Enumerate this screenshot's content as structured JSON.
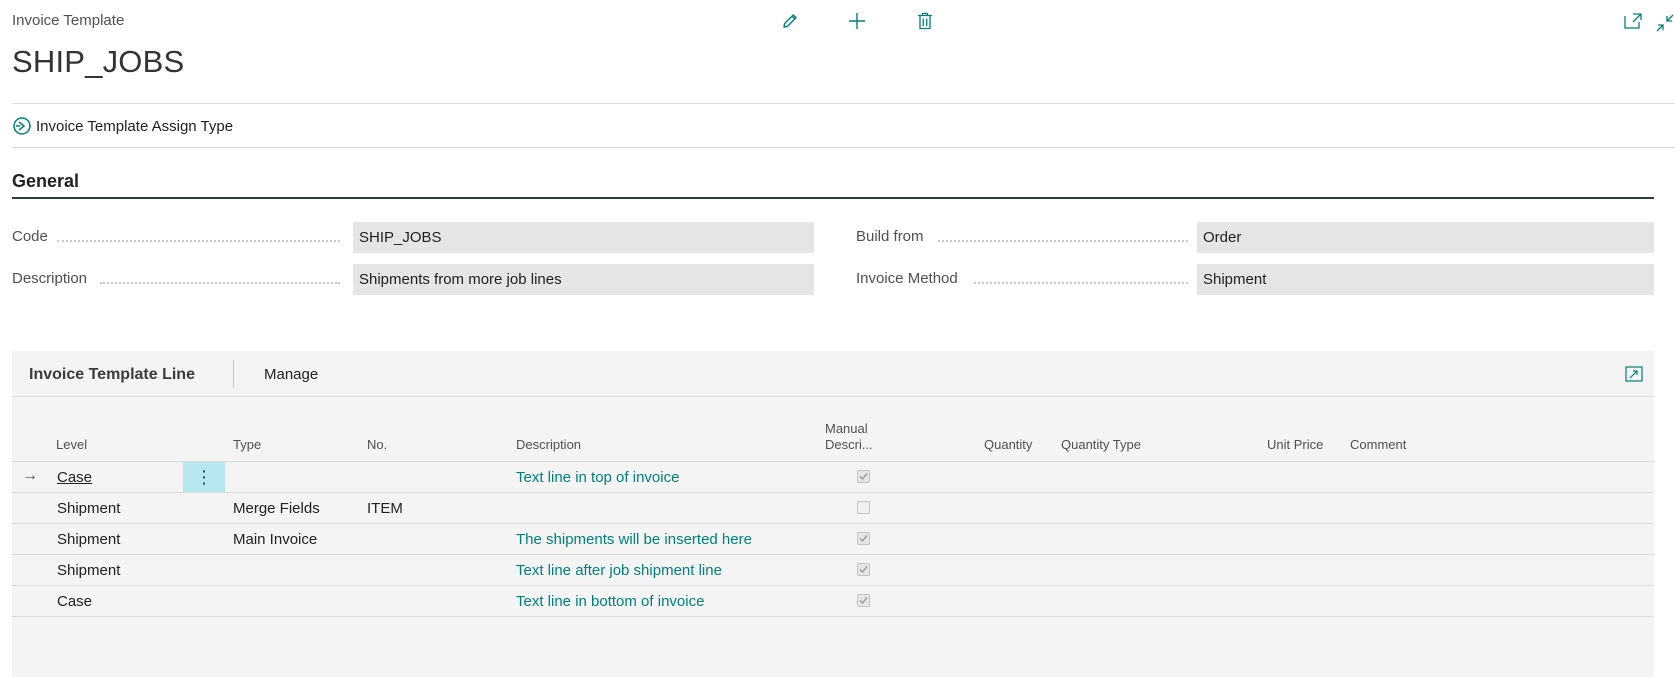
{
  "page": {
    "caption": "Invoice Template",
    "title": "SHIP_JOBS"
  },
  "actions": {
    "edit_icon": "pencil-icon",
    "new_icon": "plus-icon",
    "delete_icon": "trash-icon",
    "open_new_window_icon": "open-in-new-window-icon",
    "collapse_icon": "collapse-icon"
  },
  "promoted": {
    "assign_type_label": "Invoice Template Assign Type",
    "assign_type_icon": "assign-circle-icon"
  },
  "general": {
    "title": "General",
    "fields": {
      "code": {
        "label": "Code",
        "value": "SHIP_JOBS"
      },
      "description": {
        "label": "Description",
        "value": "Shipments from more job lines"
      },
      "build_from": {
        "label": "Build from",
        "value": "Order"
      },
      "invoice_method": {
        "label": "Invoice Method",
        "value": "Shipment"
      }
    }
  },
  "lines": {
    "title": "Invoice Template Line",
    "manage_label": "Manage",
    "expand_icon": "expand-icon",
    "columns": {
      "level": "Level",
      "type": "Type",
      "no": "No.",
      "description": "Description",
      "manual_desc_1": "Manual",
      "manual_desc_2": "Descri...",
      "quantity": "Quantity",
      "quantity_type": "Quantity Type",
      "unit_price": "Unit Price",
      "comment": "Comment"
    },
    "rows": [
      {
        "level": "Case",
        "type": "",
        "no": "",
        "description": "Text line in top of invoice",
        "manual": true
      },
      {
        "level": "Shipment",
        "type": "Merge Fields",
        "no": "ITEM",
        "description": "",
        "manual": false
      },
      {
        "level": "Shipment",
        "type": "Main Invoice",
        "no": "",
        "description": "The shipments will be inserted here",
        "manual": true
      },
      {
        "level": "Shipment",
        "type": "",
        "no": "",
        "description": "Text line after job shipment line",
        "manual": true
      },
      {
        "level": "Case",
        "type": "",
        "no": "",
        "description": "Text line in bottom of invoice",
        "manual": true
      }
    ],
    "current_row_marker": "→",
    "row_menu_glyph": "⋮"
  },
  "colors": {
    "accent": "#00807a",
    "selected_cell": "#b6e6ee"
  }
}
